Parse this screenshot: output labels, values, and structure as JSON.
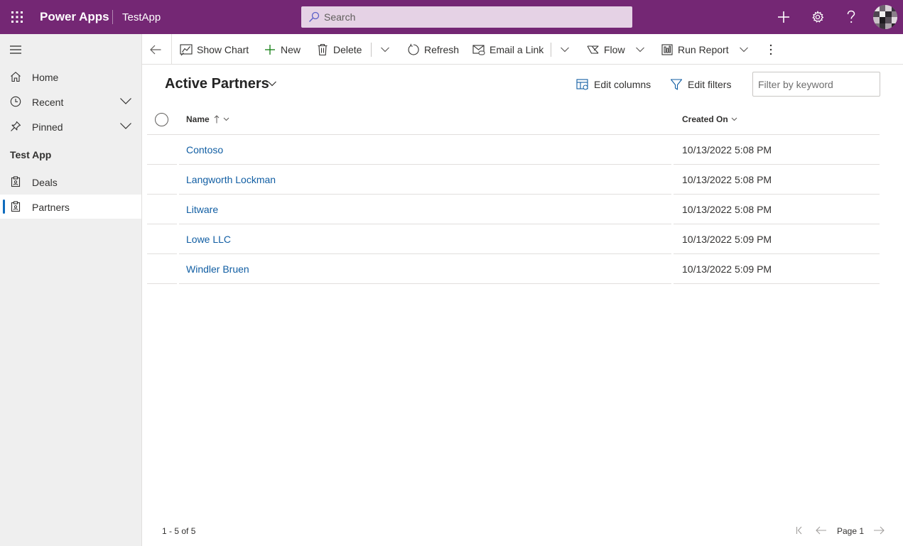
{
  "header": {
    "brand": "Power Apps",
    "app_name": "TestApp",
    "search_placeholder": "Search",
    "colors": {
      "bar": "#742774",
      "search_bg": "#e5d2e5"
    },
    "icons": [
      "waffle-icon",
      "search-icon",
      "plus-icon",
      "gear-icon",
      "help-icon",
      "avatar"
    ]
  },
  "sidebar": {
    "items": [
      {
        "label": "Home",
        "icon": "home-icon"
      },
      {
        "label": "Recent",
        "icon": "clock-icon",
        "expandable": true
      },
      {
        "label": "Pinned",
        "icon": "pin-icon",
        "expandable": true
      }
    ],
    "group_title": "Test App",
    "entities": [
      {
        "label": "Deals",
        "icon": "entity-icon",
        "selected": false
      },
      {
        "label": "Partners",
        "icon": "entity-icon",
        "selected": true
      }
    ]
  },
  "commandbar": {
    "show_chart": "Show Chart",
    "new": "New",
    "delete": "Delete",
    "refresh": "Refresh",
    "email_link": "Email a Link",
    "flow": "Flow",
    "run_report": "Run Report"
  },
  "view": {
    "title": "Active Partners",
    "edit_columns": "Edit columns",
    "edit_filters": "Edit filters",
    "filter_placeholder": "Filter by keyword"
  },
  "grid": {
    "columns": [
      "Name",
      "Created On"
    ],
    "sort": {
      "column": "Name",
      "direction": "ascending"
    },
    "rows": [
      {
        "name": "Contoso",
        "created_on": "10/13/2022 5:08 PM"
      },
      {
        "name": "Langworth Lockman",
        "created_on": "10/13/2022 5:08 PM"
      },
      {
        "name": "Litware",
        "created_on": "10/13/2022 5:08 PM"
      },
      {
        "name": "Lowe LLC",
        "created_on": "10/13/2022 5:09 PM"
      },
      {
        "name": "Windler Bruen",
        "created_on": "10/13/2022 5:09 PM"
      }
    ]
  },
  "footer": {
    "count": "1 - 5 of 5",
    "page_label": "Page 1"
  }
}
